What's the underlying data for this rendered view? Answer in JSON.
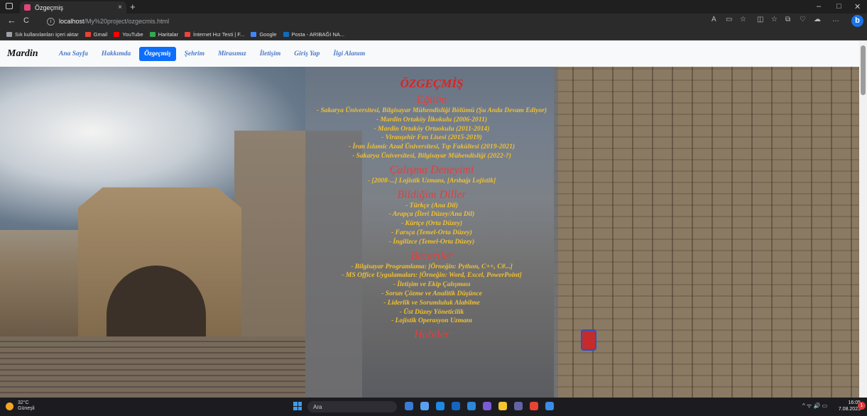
{
  "browser": {
    "tab_title": "Özgeçmiş",
    "tab_close": "×",
    "new_tab": "+",
    "url_host": "localhost",
    "url_path": "/My%20project/ozgecmis.html",
    "bookmarks": [
      {
        "label": "Sık kullanılanları içeri aktar",
        "color": "#9aa0a6"
      },
      {
        "label": "Gmail",
        "color": "#ea4335"
      },
      {
        "label": "YouTube",
        "color": "#ff0000"
      },
      {
        "label": "Haritalar",
        "color": "#34a853"
      },
      {
        "label": "İnternet Hız Testi | F...",
        "color": "#e8453c"
      },
      {
        "label": "Google",
        "color": "#4285f4"
      },
      {
        "label": "Posta - ARIBAĞI NA...",
        "color": "#0f6cbd"
      }
    ],
    "window_controls": [
      "–",
      "□",
      "✕"
    ],
    "back": "←",
    "reload": "C",
    "info": "i",
    "toolbar_icons": [
      "A",
      "▭",
      "☆",
      "◫",
      "☆",
      "⧉",
      "♡",
      "☁",
      "…"
    ],
    "bing": "b"
  },
  "site": {
    "logo": "Mardin",
    "nav": [
      {
        "label": "Ana Sayfa",
        "active": false
      },
      {
        "label": "Hakkımda",
        "active": false
      },
      {
        "label": "Özgeçmiş",
        "active": true
      },
      {
        "label": "Şehrim",
        "active": false
      },
      {
        "label": "Mirasımız",
        "active": false
      },
      {
        "label": "İletişim",
        "active": false
      },
      {
        "label": "Giriş Yap",
        "active": false
      },
      {
        "label": "İlgi Alanım",
        "active": false
      }
    ]
  },
  "resume": {
    "title": "ÖZGEÇMİŞ",
    "sections": [
      {
        "heading": "Eğitim",
        "items": [
          "- Sakarya Üniversitesi, Bilgisayar Mühendisliği Bölümü (Şu Anda Devam Ediyor)",
          "- Mardin Ortaköy İlkokulu (2006-2011)",
          "- Mardin Ortaköy Ortaokulu (2011-2014)",
          "- Viranşehir Fen Lisesi (2015-2019)",
          "- İran İslamic Azad Üniversitesi, Tıp Fakültesi (2019-2021)",
          "- Sakarya Üniversitesi, Bilgisayar Mühendisliği (2022-?)"
        ]
      },
      {
        "heading": "Çalışma Deneyimi",
        "items": [
          "- [2008-...] Lojistik Uzmanı, [Arıbağı Lojistik]"
        ]
      },
      {
        "heading": "Bildiğim Diller",
        "items": [
          "- Türkçe (Ana Dil)",
          "- Arapça (İleri Düzey/Ana Dil)",
          "- Kürtçe (Orta Düzey)",
          "- Farsça (Temel-Orta Düzey)",
          "- İngilizce (Temel-Orta Düzey)"
        ]
      },
      {
        "heading": "Beceriler",
        "items": [
          "- Bilgisayar Programlama: [Örneğin: Python, C++, C#...]",
          "- MS Office Uygulamaları: [Örneğin: Word, Excel, PowerPoint]",
          "- İletişim ve Ekip Çalışması",
          "- Sorun Çözme ve Analitik Düşünce",
          "- Liderlik ve Sorumluluk Alabilme",
          "- Üst Düzey Yöneticilik",
          "- Lojistik Operasyon Uzmanı"
        ]
      },
      {
        "heading": "Hobiler",
        "items": []
      }
    ]
  },
  "taskbar": {
    "temp": "32°C",
    "weather": "Güneşli",
    "search": "Ara",
    "tray": "^ ᯤ 🔊 ▭",
    "time": "16:05",
    "date": "7.08.2023",
    "app_colors": [
      "#3a7bd5",
      "#5aa0f0",
      "#1e88e5",
      "#1565c0",
      "#2b88d8",
      "#7b5bd6",
      "#f4c430",
      "#6264a7",
      "#ea4335",
      "#3c8ce7"
    ]
  }
}
